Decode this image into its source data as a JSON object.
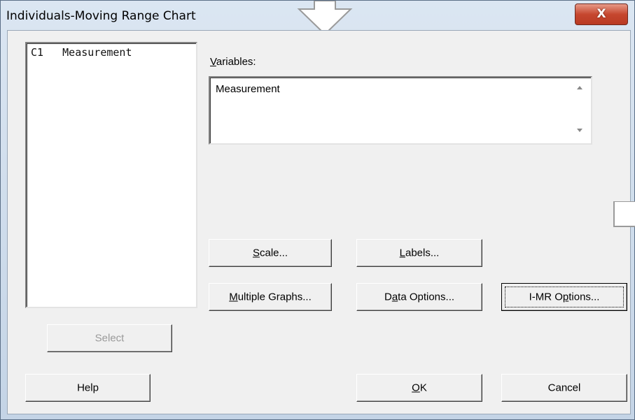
{
  "window": {
    "title": "Individuals-Moving Range Chart",
    "close_label": "X"
  },
  "columns_list": {
    "items": [
      {
        "id": "C1",
        "name": "Measurement",
        "text": "C1   Measurement"
      }
    ]
  },
  "variables": {
    "label_mn": "V",
    "label_rest": "ariables:",
    "value": "Measurement"
  },
  "buttons": {
    "scale": {
      "mn": "S",
      "rest": "cale..."
    },
    "labels": {
      "mn": "L",
      "rest": "abels..."
    },
    "multiple_graphs": {
      "mn": "M",
      "rest": "ultiple Graphs..."
    },
    "data_options": {
      "pre": "D",
      "mn": "a",
      "rest": "ta Options..."
    },
    "imr_options": {
      "pre": "I-MR O",
      "mn": "p",
      "rest": "tions..."
    },
    "select": "Select",
    "help": "Help",
    "ok": {
      "mn": "O",
      "rest": "K"
    },
    "cancel": "Cancel"
  }
}
